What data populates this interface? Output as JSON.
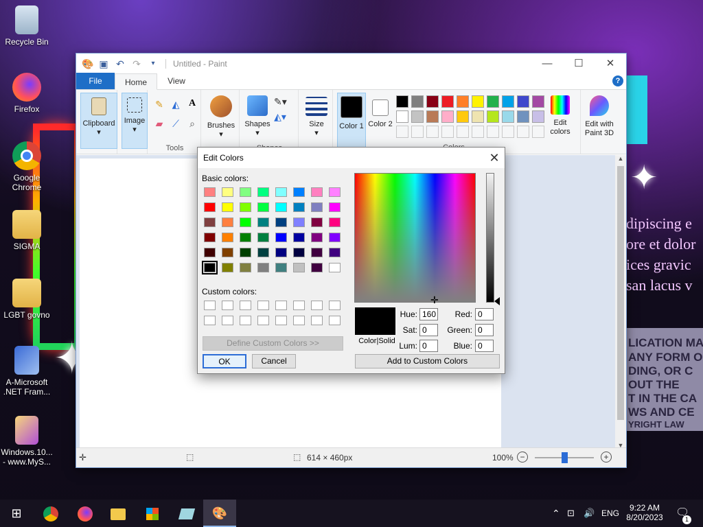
{
  "desktop": {
    "icons": [
      {
        "label": "Recycle Bin",
        "icon": "recycle-bin-icon"
      },
      {
        "label": "Firefox",
        "icon": "firefox-icon"
      },
      {
        "label": "Google Chrome",
        "icon": "chrome-icon"
      },
      {
        "label": "SIGMA",
        "icon": "folder-icon"
      },
      {
        "label": "LGBT govno",
        "icon": "document-icon"
      },
      {
        "label": "A-Microsoft .NET Fram...",
        "icon": "installer-icon"
      },
      {
        "label": "Windows.10... - www.MyS...",
        "icon": "archive-icon"
      }
    ],
    "bg_text_lines": [
      "dipiscing e",
      "ore et dolor",
      "ices gravic",
      "san lacus v"
    ],
    "bg_license_lines": [
      "LICATION MA",
      "ANY FORM O",
      "DING, OR C",
      "OUT THE",
      "T IN THE CA",
      "WS AND CE",
      "YRIGHT LAW"
    ]
  },
  "paint": {
    "title": "Untitled - Paint",
    "tabs": [
      "File",
      "Home",
      "View"
    ],
    "groups": {
      "clipboard": "Clipboard",
      "image": "Image",
      "tools": "Tools",
      "brushes": "Brushes",
      "shapes": "Shapes",
      "size": "Size",
      "color1": "Color 1",
      "color2": "Color 2",
      "edit_colors": "Edit colors",
      "paint3d": "Edit with Paint 3D",
      "colors": "Colors"
    },
    "palette_row1": [
      "#000000",
      "#7f7f7f",
      "#880015",
      "#ed1c24",
      "#ff7f27",
      "#fff200",
      "#22b14c",
      "#00a2e8",
      "#3f48cc",
      "#a349a4"
    ],
    "palette_row2": [
      "#ffffff",
      "#c3c3c3",
      "#b97a57",
      "#ffaec9",
      "#ffc90e",
      "#efe4b0",
      "#b5e61d",
      "#99d9ea",
      "#7092be",
      "#c8bfe7"
    ],
    "status": {
      "canvas_size": "614 × 460px",
      "zoom": "100%",
      "zoom_slider_fraction": 0.5
    }
  },
  "dialog": {
    "title": "Edit Colors",
    "basic_label": "Basic colors:",
    "custom_label": "Custom colors:",
    "define_custom": "Define Custom Colors >>",
    "ok": "OK",
    "cancel": "Cancel",
    "color_solid": "Color|Solid",
    "add_custom": "Add to Custom Colors",
    "labels": {
      "hue": "Hue:",
      "sat": "Sat:",
      "lum": "Lum:",
      "red": "Red:",
      "green": "Green:",
      "blue": "Blue:"
    },
    "values": {
      "hue": "160",
      "sat": "0",
      "lum": "0",
      "red": "0",
      "green": "0",
      "blue": "0"
    },
    "basic_colors": [
      [
        "#ff8080",
        "#ffff80",
        "#80ff80",
        "#00ff80",
        "#80ffff",
        "#0080ff",
        "#ff80c0",
        "#ff80ff"
      ],
      [
        "#ff0000",
        "#ffff00",
        "#80ff00",
        "#00ff40",
        "#00ffff",
        "#0080c0",
        "#8080c0",
        "#ff00ff"
      ],
      [
        "#804040",
        "#ff8040",
        "#00ff00",
        "#008080",
        "#004080",
        "#8080ff",
        "#800040",
        "#ff0080"
      ],
      [
        "#800000",
        "#ff8000",
        "#008000",
        "#008040",
        "#0000ff",
        "#0000a0",
        "#800080",
        "#8000ff"
      ],
      [
        "#400000",
        "#804000",
        "#004000",
        "#004040",
        "#000080",
        "#000040",
        "#400040",
        "#400080"
      ],
      [
        "#000000",
        "#808000",
        "#808040",
        "#808080",
        "#408080",
        "#c0c0c0",
        "#400040",
        "#ffffff"
      ]
    ]
  },
  "taskbar": {
    "apps": [
      "start-icon",
      "chrome-icon",
      "firefox-icon",
      "file-explorer-icon",
      "store-icon",
      "app-icon",
      "paint-icon"
    ],
    "lang": "ENG",
    "time": "9:22 AM",
    "date": "8/20/2023",
    "notifications": "1"
  }
}
